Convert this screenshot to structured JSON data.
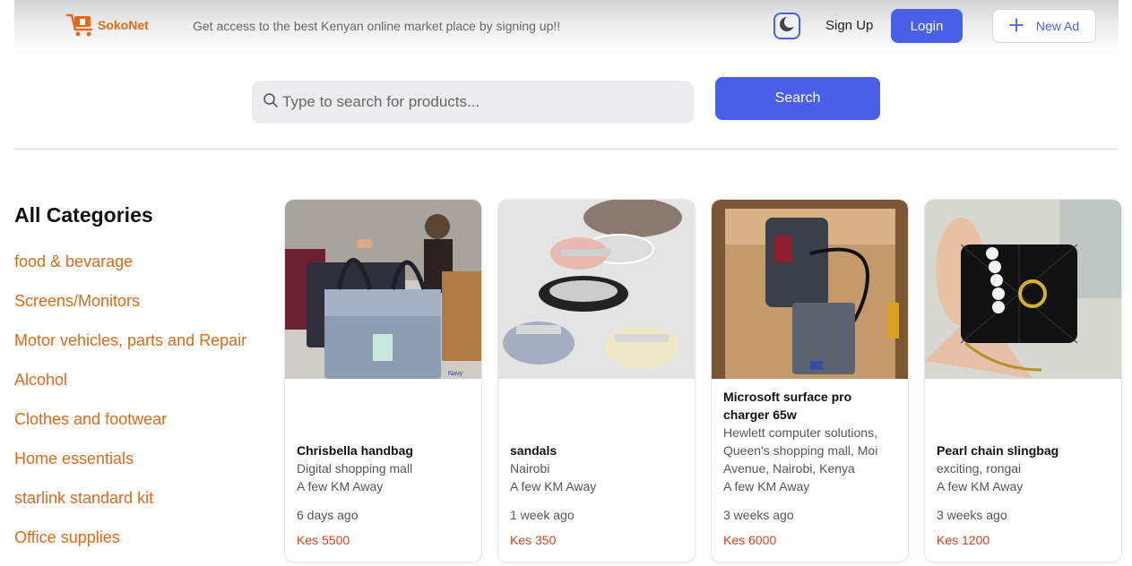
{
  "header": {
    "logo_text": "SokoNet",
    "tagline": "Get access to the best Kenyan online market place by signing up!!",
    "theme_icon": "moon-icon",
    "signup_label": "Sign Up",
    "login_label": "Login",
    "new_ad_label": "New Ad"
  },
  "search": {
    "placeholder": "Type to search for products...",
    "value": "",
    "button_label": "Search"
  },
  "categories": {
    "title": "All Categories",
    "items": [
      "food & bevarage",
      "Screens/Monitors",
      "Motor vehicles, parts and Repair",
      "Alcohol",
      "Clothes and footwear",
      "Home essentials",
      "starlink standard kit",
      "Office supplies"
    ]
  },
  "products": [
    {
      "name": "Chrisbella handbag",
      "location": "Digital shopping mall",
      "distance": "A few KM Away",
      "age": "6 days ago",
      "price": "Kes 5500",
      "image_label": "Navy"
    },
    {
      "name": "sandals",
      "location": "Nairobi",
      "distance": "A few KM Away",
      "age": "1 week ago",
      "price": "Kes 350"
    },
    {
      "name": "Microsoft surface pro charger 65w",
      "location": "Hewlett computer solutions, Queen's shopping mall, Moi Avenue, Nairobi, Kenya",
      "distance": "A few KM Away",
      "age": "3 weeks ago",
      "price": "Kes 6000"
    },
    {
      "name": "Pearl chain slingbag",
      "location": "exciting, rongai",
      "distance": "A few KM Away",
      "age": "3 weeks ago",
      "price": "Kes 1200"
    }
  ],
  "colors": {
    "accent": "#4a5fe8",
    "category_text": "#e2691a",
    "price": "#d2421b"
  }
}
